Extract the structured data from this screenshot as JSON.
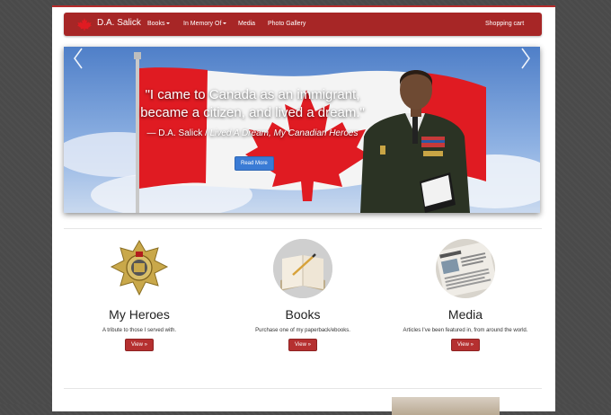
{
  "navbar": {
    "brand": "D.A. Salick",
    "items": [
      {
        "label": "Books",
        "dropdown": true
      },
      {
        "label": "In Memory Of",
        "dropdown": true
      },
      {
        "label": "Media",
        "dropdown": false
      },
      {
        "label": "Photo Gallery",
        "dropdown": false
      }
    ],
    "cart": "Shopping cart",
    "color": "#a72626"
  },
  "carousel": {
    "quote_line1": "\"I came to Canada as an immigrant,",
    "quote_line2": "became a citizen, and lived a dream.\"",
    "attribution_prefix": "— D.A. Salick /",
    "attribution_titles": "Lived A Dream, My Canadian Heroes",
    "button": "Read More",
    "prev_icon": "chevron-left-icon",
    "next_icon": "chevron-right-icon"
  },
  "features": [
    {
      "title": "My Heroes",
      "text": "A tribute to those I served with.",
      "button": "View »",
      "icon": "badge-icon"
    },
    {
      "title": "Books",
      "text": "Purchase one of my paperback/ebooks.",
      "button": "View »",
      "icon": "notebook-icon"
    },
    {
      "title": "Media",
      "text": "Articles I've been featured in, from around the world.",
      "button": "View »",
      "icon": "newspaper-icon"
    }
  ],
  "colors": {
    "accent": "#a72626",
    "button_blue": "#3a7bd5",
    "flag_red": "#e01b22"
  }
}
